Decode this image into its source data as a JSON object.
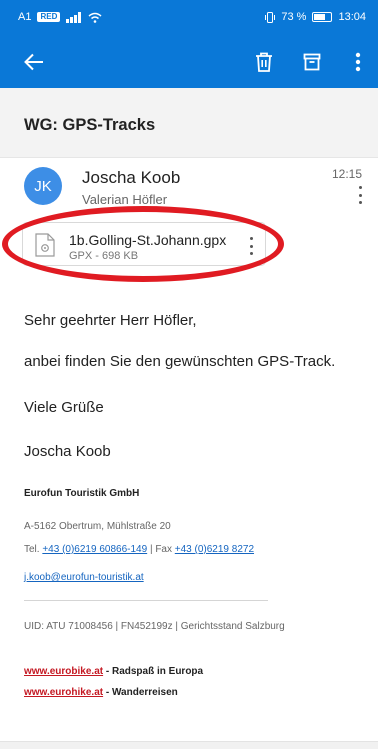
{
  "status_bar": {
    "carrier": "A1",
    "carrier_badge": "RED",
    "battery_text": "73 %",
    "clock": "13:04"
  },
  "app_bar": {
    "color": "#0a78d7",
    "icons": [
      "back-arrow-icon",
      "delete-icon",
      "archive-icon",
      "more-vertical-icon"
    ]
  },
  "email": {
    "subject": "WG: GPS-Tracks",
    "avatar_initials": "JK",
    "sender": "Joscha Koob",
    "recipient": "Valerian Höfler",
    "time": "12:15",
    "attachment": {
      "name": "1b.Golling-St.Johann.gpx",
      "meta": "GPX - 698 KB"
    },
    "body": {
      "greeting": "Sehr geehrter Herr Höfler,",
      "line1": "anbei finden Sie den gewünschten GPS-Track.",
      "closing": "Viele Grüße",
      "name": "Joscha Koob"
    },
    "signature": {
      "company": "Eurofun Touristik GmbH",
      "address": "A-5162 Obertrum, Mühlstraße 20",
      "tel_label": "Tel.",
      "tel": "+43 (0)6219 60866-149",
      "separator": "|",
      "fax_label": "Fax",
      "fax": "+43 (0)6219 8272",
      "email": "j.koob@eurofun-touristik.at",
      "uid": "UID: ATU 71008456 | FN452199z | Gerichtsstand Salzburg",
      "link1": "www.eurobike.at",
      "link1_desc": " - Radspaß in Europa",
      "link2": "www.eurohike.at",
      "link2_desc": " - Wanderreisen"
    }
  },
  "highlight_color": "#e01b22"
}
